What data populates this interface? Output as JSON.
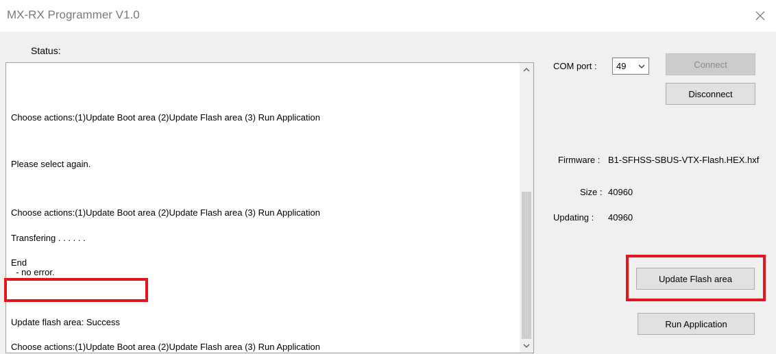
{
  "window": {
    "title": "MX-RX Programmer V1.0",
    "close_icon": "close-icon"
  },
  "status": {
    "label": "Status:"
  },
  "log": {
    "lines": [
      "Choose actions:(1)Update Boot area (2)Update Flash area (3) Run Application",
      "Please select again.",
      "Choose actions:(1)Update Boot area (2)Update Flash area (3) Run Application",
      "Transfering . . . . . .",
      "End",
      "  - no error.",
      "Update flash area: Success",
      "Choose actions:(1)Update Boot area (2)Update Flash area (3) Run Application"
    ]
  },
  "connection": {
    "com_port_label": "COM port :",
    "com_port_value": "49",
    "connect_label": "Connect",
    "disconnect_label": "Disconnect"
  },
  "info": {
    "firmware_label": "Firmware :",
    "firmware_value": "B1-SFHSS-SBUS-VTX-Flash.HEX.hxf",
    "size_label": "Size :",
    "size_value": "40960",
    "updating_label": "Updating :",
    "updating_value": "40960"
  },
  "actions": {
    "update_flash_label": "Update Flash area",
    "run_application_label": "Run Application"
  },
  "colors": {
    "highlight": "#e3161f",
    "panel_background": "#f0f0f0",
    "button_face": "#e1e1e1"
  }
}
